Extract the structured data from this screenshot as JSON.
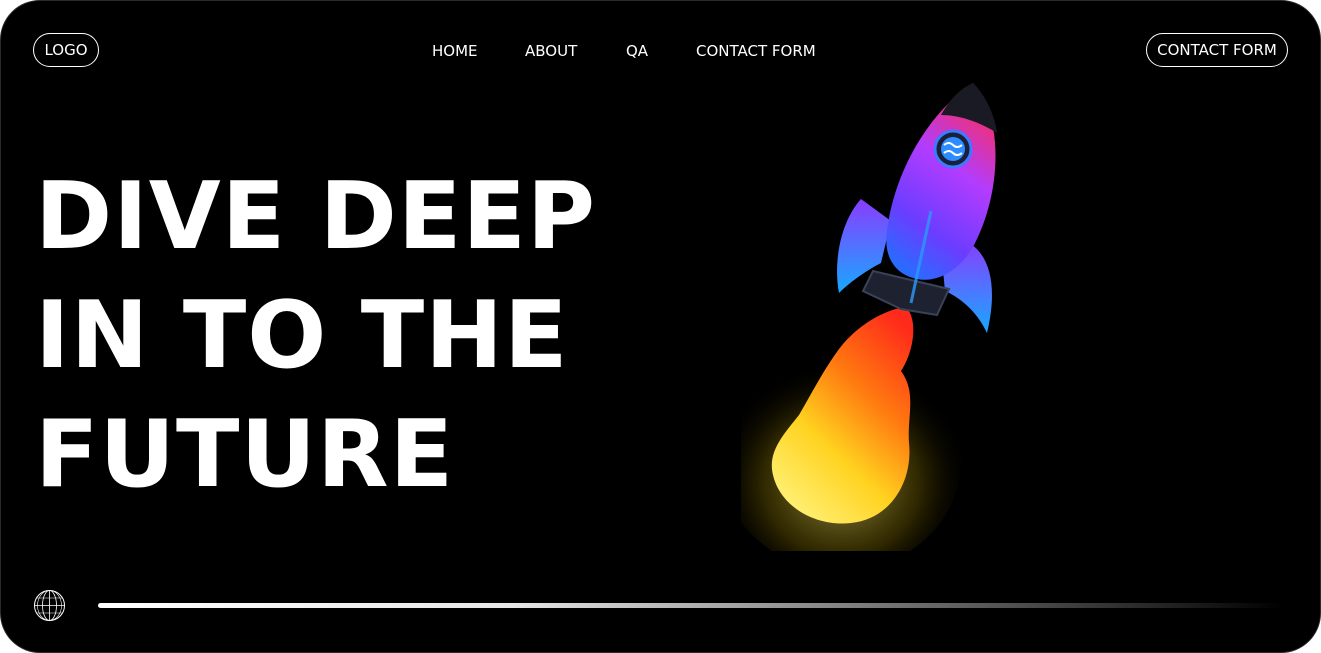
{
  "header": {
    "logo_label": "LOGO",
    "nav": [
      {
        "label": "HOME"
      },
      {
        "label": "ABOUT"
      },
      {
        "label": "QA"
      },
      {
        "label": "CONTACT FORM"
      }
    ],
    "cta_label": "CONTACT FORM"
  },
  "hero": {
    "headline_lines": [
      "DIVE DEEP",
      "IN TO THE",
      "FUTURE"
    ],
    "image_icon": "rocket-launch-illustration"
  },
  "footer": {
    "globe_icon": "globe-icon",
    "progress_fraction": 1.0
  },
  "colors": {
    "background": "#000000",
    "text": "#ffffff",
    "rocket_body_top": "#ff2d55",
    "rocket_body_mid": "#8a2be2",
    "rocket_body_bottom": "#1e90ff",
    "flame_outer": "#ff3b1f",
    "flame_inner": "#ffe94d"
  }
}
